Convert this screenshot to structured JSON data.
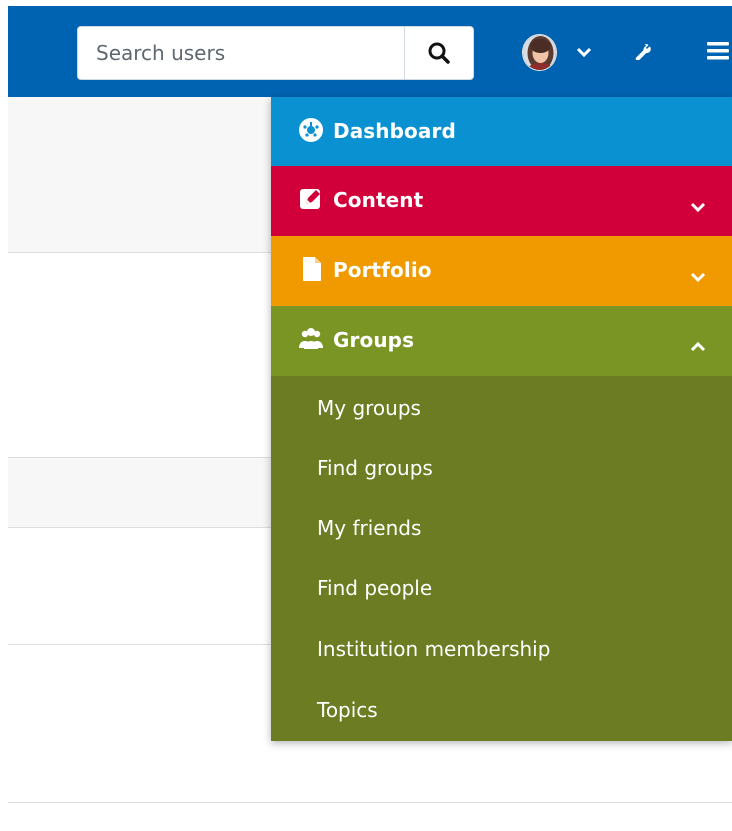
{
  "header": {
    "search": {
      "placeholder": "Search users"
    },
    "icons": {
      "search": "search-icon",
      "user": "avatar",
      "user_menu": "chevron-down-icon",
      "admin": "wrench-icon",
      "main_menu": "hamburger-icon"
    }
  },
  "menu": {
    "items": [
      {
        "label": "Dashboard",
        "icon": "dashboard-icon",
        "color": "#0A91D1"
      },
      {
        "label": "Content",
        "icon": "pencil-icon",
        "color": "#D1003A"
      },
      {
        "label": "Portfolio",
        "icon": "file-icon",
        "color": "#F09A00"
      },
      {
        "label": "Groups",
        "icon": "users-icon",
        "color": "#7A9524"
      }
    ],
    "groups_submenu": [
      "My groups",
      "Find groups",
      "My friends",
      "Find people",
      "Institution membership",
      "Topics"
    ]
  }
}
